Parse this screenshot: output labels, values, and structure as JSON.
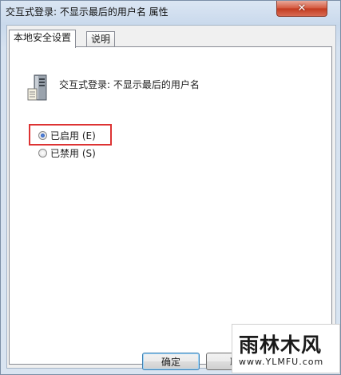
{
  "window": {
    "title": "交互式登录: 不显示最后的用户名 属性",
    "close_glyph": "✕"
  },
  "tabs": [
    {
      "label": "本地安全设置",
      "active": true
    },
    {
      "label": "说明",
      "active": false
    }
  ],
  "policy": {
    "title": "交互式登录: 不显示最后的用户名"
  },
  "options": [
    {
      "label": "已启用 (E)",
      "checked": true
    },
    {
      "label": "已禁用 (S)",
      "checked": false
    }
  ],
  "buttons": {
    "ok": "确定",
    "cancel": "取"
  },
  "watermark": {
    "logo": "雨林木风",
    "url": "www.YLMFU.com"
  },
  "colors": {
    "highlight": "#dd3333",
    "close_button": "#c9482d"
  }
}
